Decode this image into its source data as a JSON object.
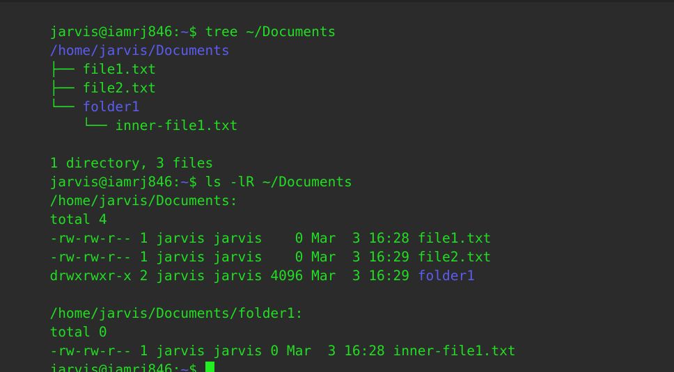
{
  "terminal": {
    "app": "gnome-terminal",
    "background_color": "#2b2b2b",
    "foreground_color": "#22dd22",
    "dir_color": "#5c5cf0",
    "cursor_color": "#22ee22",
    "user": "jarvis",
    "host": "iamrj846",
    "cwd_short": "~",
    "cols": 74,
    "rows": 19
  },
  "prompt": {
    "user_host": "jarvis@iamrj846",
    "colon": ":",
    "path": "~",
    "dollar": "$ "
  },
  "commands": {
    "tree": "tree ~/Documents",
    "ls": "ls -lR ~/Documents"
  },
  "tree_output": {
    "root": "/home/jarvis/Documents",
    "entries": [
      {
        "branch": "├── ",
        "indent": "",
        "name": "file1.txt",
        "type": "file"
      },
      {
        "branch": "├── ",
        "indent": "",
        "name": "file2.txt",
        "type": "file"
      },
      {
        "branch": "└── ",
        "indent": "",
        "name": "folder1",
        "type": "dir"
      },
      {
        "branch": "└── ",
        "indent": "    ",
        "name": "inner-file1.txt",
        "type": "file"
      }
    ],
    "blank": "",
    "summary": "1 directory, 3 files"
  },
  "ls_output": {
    "sections": [
      {
        "header": "/home/jarvis/Documents:",
        "total": "total 4",
        "rows": [
          {
            "meta": "-rw-rw-r-- 1 jarvis jarvis    0 Mar  3 16:28 ",
            "name": "file1.txt",
            "type": "file"
          },
          {
            "meta": "-rw-rw-r-- 1 jarvis jarvis    0 Mar  3 16:29 ",
            "name": "file2.txt",
            "type": "file"
          },
          {
            "meta": "drwxrwxr-x 2 jarvis jarvis 4096 Mar  3 16:29 ",
            "name": "folder1",
            "type": "dir"
          }
        ]
      },
      {
        "header": "/home/jarvis/Documents/folder1:",
        "total": "total 0",
        "rows": [
          {
            "meta": "-rw-rw-r-- 1 jarvis jarvis 0 Mar  3 16:28 ",
            "name": "inner-file1.txt",
            "type": "file"
          }
        ]
      }
    ],
    "blank": ""
  }
}
